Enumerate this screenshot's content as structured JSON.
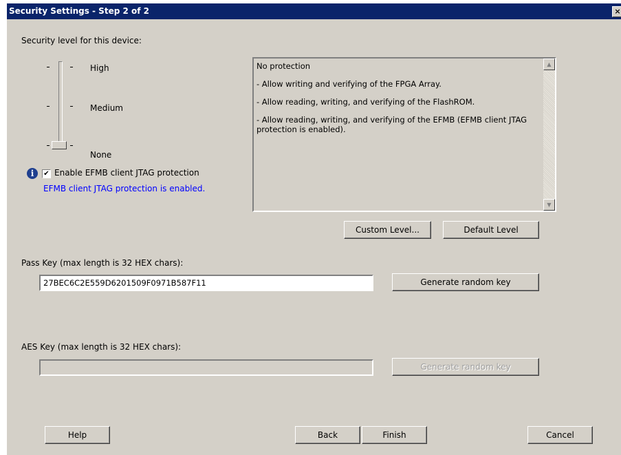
{
  "window": {
    "title": "Security Settings - Step 2 of 2",
    "close_glyph": "×"
  },
  "security_level": {
    "label": "Security level for this device:",
    "levels": [
      "High",
      "Medium",
      "None"
    ],
    "selected": "None"
  },
  "jtag": {
    "checkbox_label": "Enable EFMB client JTAG protection",
    "checked": true,
    "status_text": "EFMB client JTAG protection is enabled.",
    "status_color": "#0000ff"
  },
  "description": {
    "lines": [
      "No protection",
      "- Allow writing and verifying of the FPGA Array.",
      "- Allow reading, writing, and verifying of the FlashROM.",
      "- Allow reading, writing, and verifying of the EFMB (EFMB client JTAG protection is enabled)."
    ]
  },
  "buttons": {
    "custom_level": "Custom Level...",
    "default_level": "Default Level",
    "generate_pass": "Generate random key",
    "generate_aes": "Generate random key",
    "help": "Help",
    "back": "Back",
    "finish": "Finish",
    "cancel": "Cancel"
  },
  "pass_key": {
    "label": "Pass Key (max length is 32 HEX chars):",
    "value": "27BEC6C2E559D6201509F0971B587F11"
  },
  "aes_key": {
    "label": "AES Key (max length is 32 HEX chars):",
    "value": "",
    "enabled": false
  },
  "colors": {
    "titlebar": "#0a246a",
    "dialog_bg": "#d4d0c8"
  }
}
